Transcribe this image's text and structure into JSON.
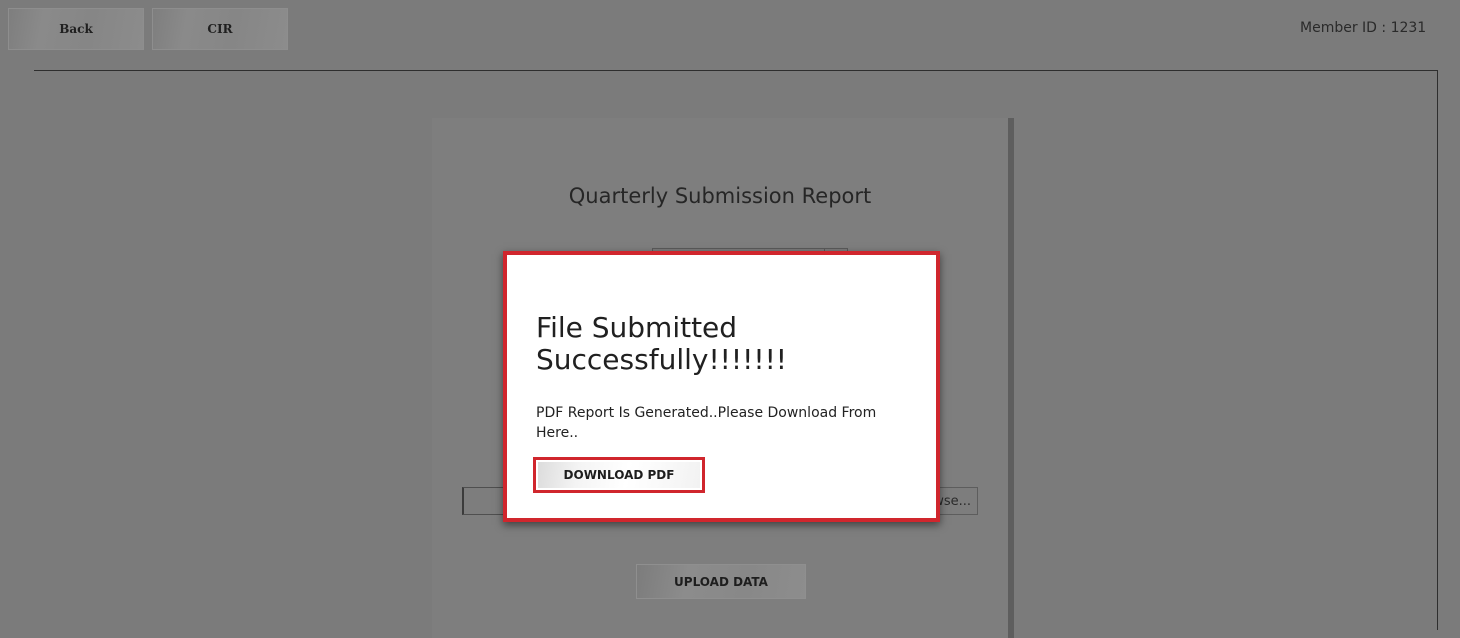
{
  "toolbar": {
    "back_label": "Back",
    "cir_label": "CIR",
    "member_id": "Member ID : 1231"
  },
  "report": {
    "title": "Quarterly Submission Report",
    "browse_label": "Browse...",
    "upload_label": "UPLOAD DATA"
  },
  "modal": {
    "heading": "File Submitted Successfully!!!!!!!",
    "message": "PDF Report Is Generated..Please Download From Here..",
    "download_label": "DOWNLOAD PDF",
    "accent_color": "#d0262d"
  }
}
